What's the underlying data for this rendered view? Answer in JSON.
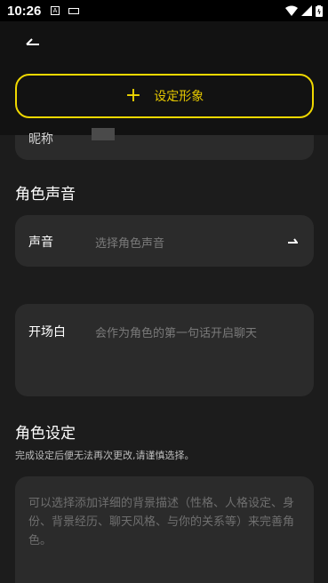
{
  "status": {
    "time": "10:26",
    "notif_glyph": "A"
  },
  "header": {
    "back_icon": "back-arrow-icon"
  },
  "avatar": {
    "label": "设定形象"
  },
  "nickname": {
    "label": "昵称"
  },
  "voice_section": {
    "title": "角色声音",
    "voice_label": "声音",
    "voice_placeholder": "选择角色声音"
  },
  "opening": {
    "label": "开场白",
    "placeholder": "会作为角色的第一句话开启聊天"
  },
  "character": {
    "title": "角色设定",
    "hint": "完成设定后便无法再次更改,请谨慎选择。",
    "placeholder": "可以选择添加详细的背景描述（性格、人格设定、身份、背景经历、聊天风格、与你的关系等）来完善角色。"
  },
  "colors": {
    "accent": "#f0d800",
    "card": "#2b2b2b",
    "background": "#1c1c1c"
  }
}
